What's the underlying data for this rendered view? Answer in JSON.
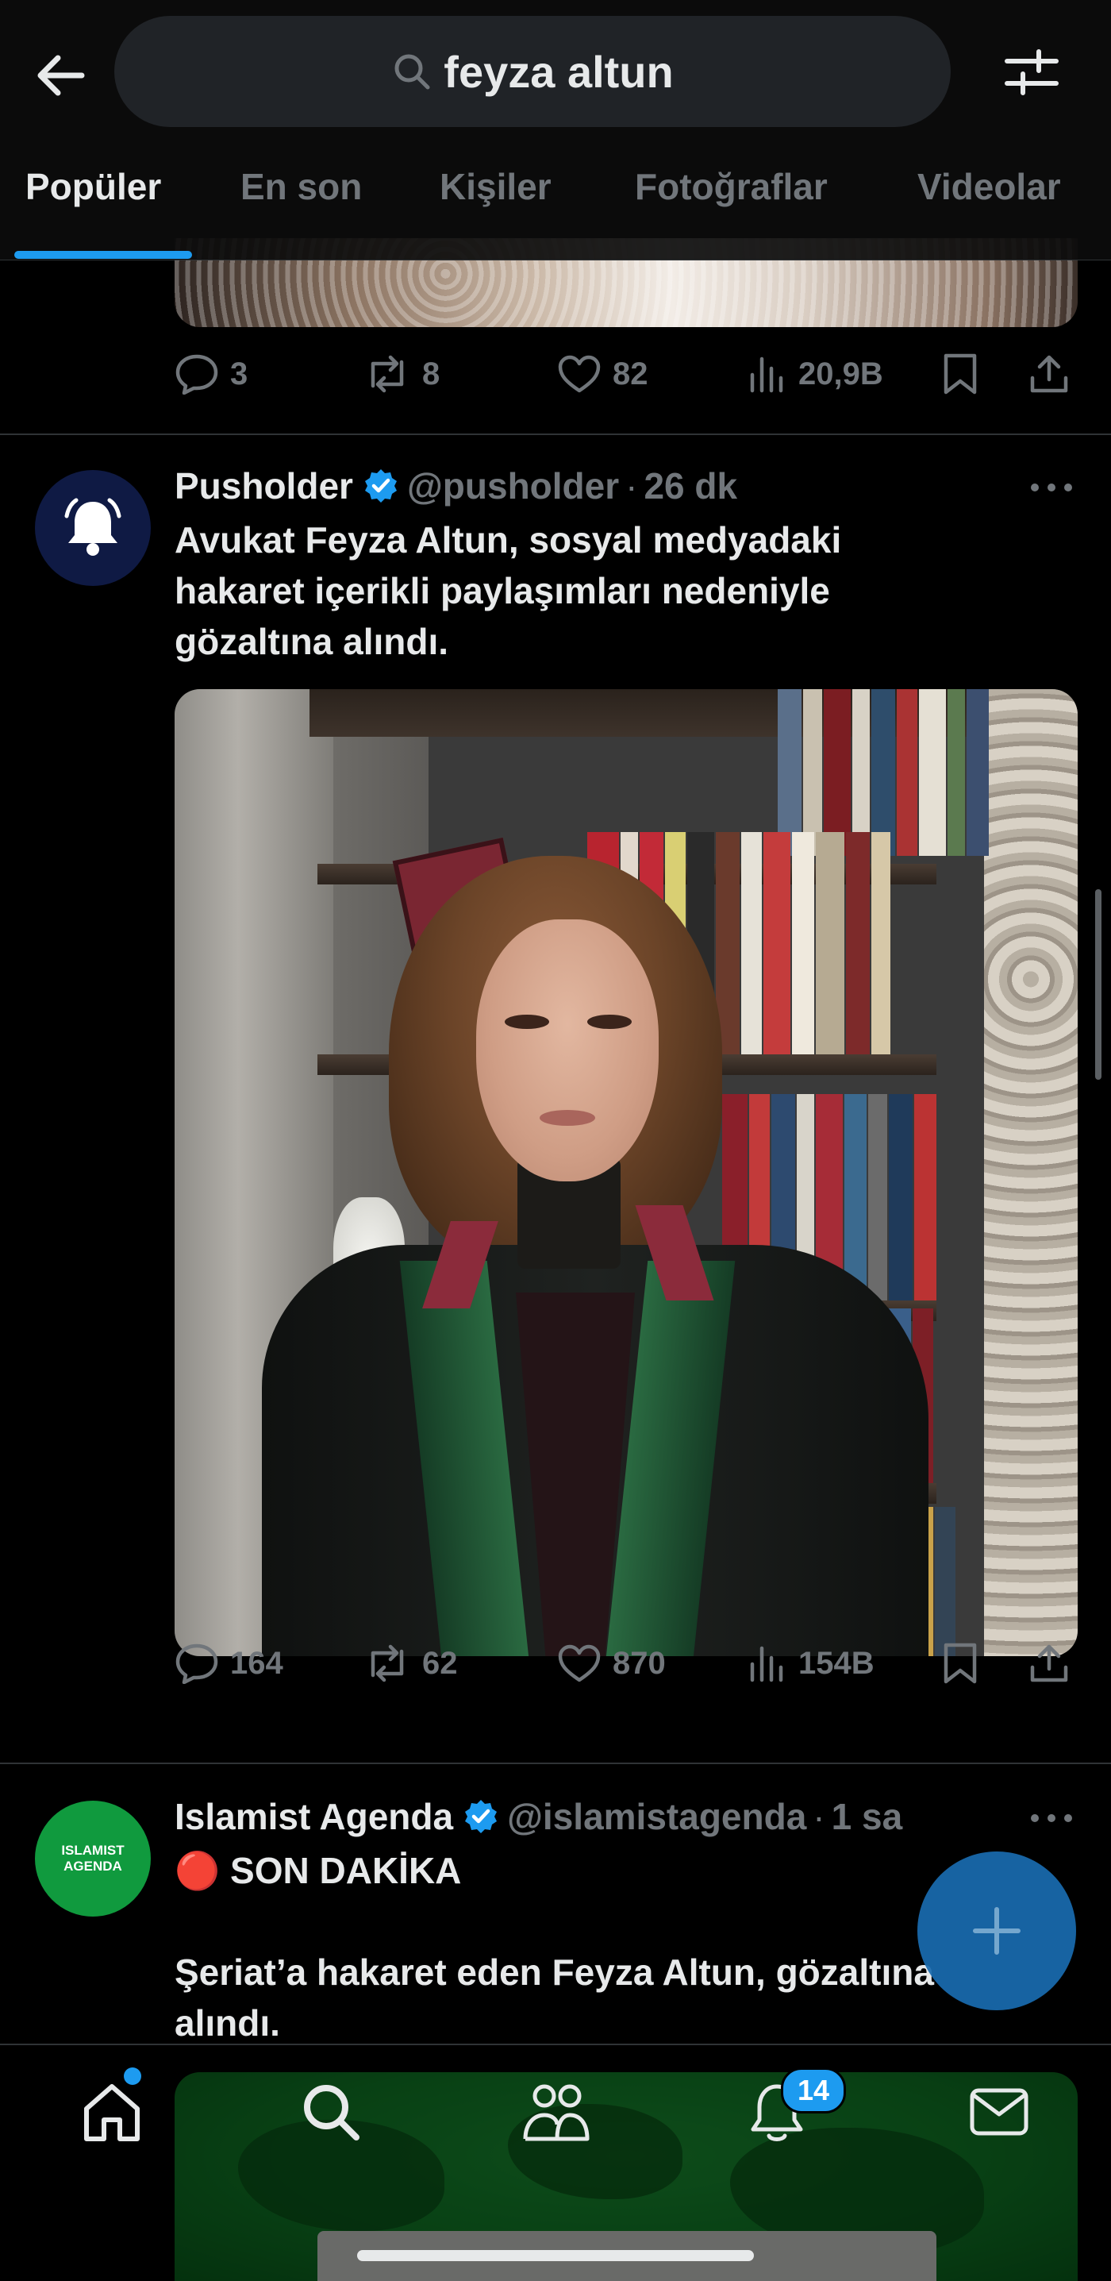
{
  "search": {
    "query": "feyza altun"
  },
  "tabs": [
    "Popüler",
    "En son",
    "Kişiler",
    "Fotoğraflar",
    "Videolar"
  ],
  "prev_tweet": {
    "replies": "3",
    "reposts": "8",
    "likes": "82",
    "views": "20,9B"
  },
  "tweet1": {
    "name": "Pusholder",
    "handle": "@pusholder",
    "time": "26 dk",
    "text": "Avukat Feyza Altun, sosyal medyadaki\nhakaret içerikli paylaşımları nedeniyle\ngözaltına alındı.",
    "replies": "164",
    "reposts": "62",
    "likes": "870",
    "views": "154B"
  },
  "tweet2": {
    "name": "Islamist Agenda",
    "handle": "@islamistagenda",
    "time": "1 sa",
    "avatar_text": "ISLAMIST AGENDA",
    "text": "🔴 SON DAKİKA\n\nŞeriat’a hakaret eden Feyza Altun, gözaltına\nalındı."
  },
  "notifications_badge": "14",
  "colors": {
    "accent": "#1d9bf0",
    "background": "#000000",
    "muted": "#71767b",
    "green_avatar": "#109a3e"
  },
  "icons": [
    "back-arrow-icon",
    "search-icon",
    "filter-icon",
    "reply-icon",
    "repost-icon",
    "like-icon",
    "views-icon",
    "bookmark-icon",
    "share-icon",
    "verified-icon",
    "more-icon",
    "compose-plus-icon",
    "home-icon",
    "explore-icon",
    "communities-icon",
    "notifications-icon",
    "messages-icon",
    "bell-icon"
  ]
}
